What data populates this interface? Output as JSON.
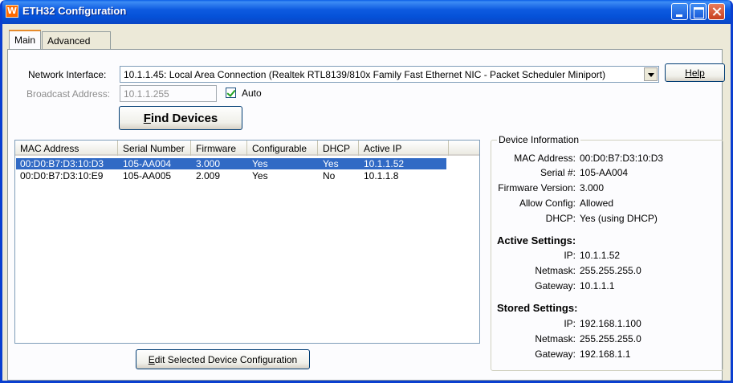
{
  "window": {
    "title": "ETH32 Configuration",
    "app_icon_glyph": "W"
  },
  "tabs": [
    {
      "label": "Main",
      "active": true
    },
    {
      "label": "Advanced",
      "active": false
    }
  ],
  "network": {
    "label": "Network Interface:",
    "value": "10.1.1.45: Local Area Connection (Realtek RTL8139/810x Family Fast Ethernet NIC - Packet Scheduler Miniport)",
    "help_label": "Help"
  },
  "broadcast": {
    "label": "Broadcast Address:",
    "value": "10.1.1.255",
    "auto_label": "Auto",
    "auto_checked": true
  },
  "find_button": {
    "underlined_letter": "F",
    "rest": "ind Devices"
  },
  "device_list": {
    "columns": [
      "MAC Address",
      "Serial Number",
      "Firmware",
      "Configurable",
      "DHCP",
      "Active IP"
    ],
    "rows": [
      {
        "mac": "00:D0:B7:D3:10:D3",
        "serial": "105-AA004",
        "firmware": "3.000",
        "configurable": "Yes",
        "dhcp": "Yes",
        "ip": "10.1.1.52",
        "selected": true
      },
      {
        "mac": "00:D0:B7:D3:10:E9",
        "serial": "105-AA005",
        "firmware": "2.009",
        "configurable": "Yes",
        "dhcp": "No",
        "ip": "10.1.1.8",
        "selected": false
      }
    ]
  },
  "edit_button": {
    "underlined_letter": "E",
    "rest": "dit Selected Device Configuration"
  },
  "device_info": {
    "title": "Device Information",
    "mac_label": "MAC Address:",
    "mac_value": "00:D0:B7:D3:10:D3",
    "serial_label": "Serial #:",
    "serial_value": "105-AA004",
    "firmware_label": "Firmware Version:",
    "firmware_value": "3.000",
    "allow_label": "Allow Config:",
    "allow_value": "Allowed",
    "dhcp_label": "DHCP:",
    "dhcp_value": "Yes (using DHCP)",
    "active_heading": "Active Settings:",
    "active_ip_label": "IP:",
    "active_ip_value": "10.1.1.52",
    "active_mask_label": "Netmask:",
    "active_mask_value": "255.255.255.0",
    "active_gw_label": "Gateway:",
    "active_gw_value": "10.1.1.1",
    "stored_heading": "Stored Settings:",
    "stored_ip_label": "IP:",
    "stored_ip_value": "192.168.1.100",
    "stored_mask_label": "Netmask:",
    "stored_mask_value": "255.255.255.0",
    "stored_gw_label": "Gateway:",
    "stored_gw_value": "192.168.1.1"
  }
}
